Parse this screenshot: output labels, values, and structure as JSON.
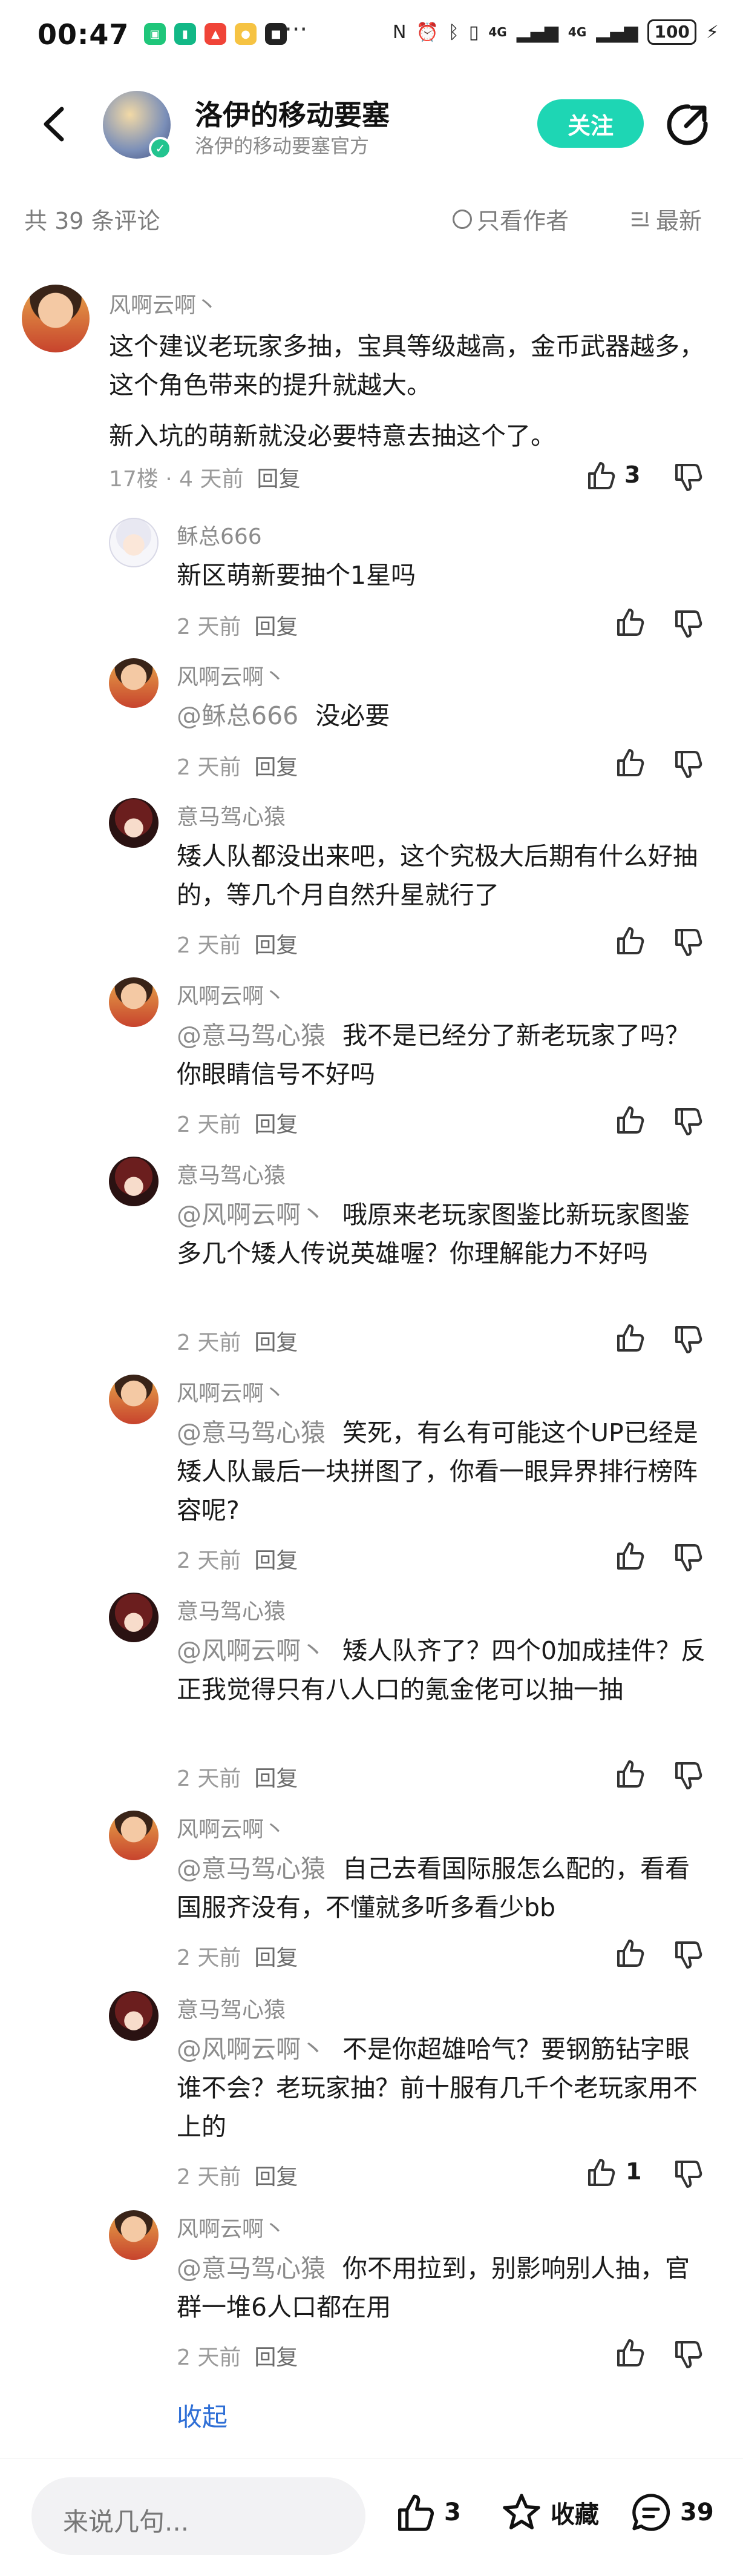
{
  "status_bar": {
    "time": "00:47",
    "more": "···",
    "signal_a": "4G",
    "signal_b": "4G",
    "battery": "100"
  },
  "header": {
    "title": "洛伊的移动要塞",
    "subtitle": "洛伊的移动要塞官方",
    "follow_label": "关注"
  },
  "sort_bar": {
    "count": "共 39 条评论",
    "only_author": "只看作者",
    "sort": "最新"
  },
  "main_comment": {
    "user": "风啊云啊丶",
    "text_1": "这个建议老玩家多抽，宝具等级越高，金币武器越多，这个角色带来的提升就越大。",
    "text_2": "新入坑的萌新就没必要特意去抽这个了。",
    "meta": "17楼 · 4 天前",
    "reply_label": "回复",
    "likes": "3"
  },
  "replies": [
    {
      "user": "稣总666",
      "mention": "",
      "text": "新区萌新要抽个1星吗",
      "time": "2 天前",
      "reply": "回复",
      "likes": ""
    },
    {
      "user": "风啊云啊丶",
      "mention": "@稣总666",
      "text": "没必要",
      "time": "2 天前",
      "reply": "回复",
      "likes": ""
    },
    {
      "user": "意马驾心猿",
      "mention": "",
      "text": "矮人队都没出来吧，这个究极大后期有什么好抽的，等几个月自然升星就行了",
      "time": "2 天前",
      "reply": "回复",
      "likes": ""
    },
    {
      "user": "风啊云啊丶",
      "mention": "@意马驾心猿",
      "text": "我不是已经分了新老玩家了吗？你眼睛信号不好吗",
      "time": "2 天前",
      "reply": "回复",
      "likes": ""
    },
    {
      "user": "意马驾心猿",
      "mention": "@风啊云啊丶",
      "text": "哦原来老玩家图鉴比新玩家图鉴多几个矮人传说英雄喔？你理解能力不好吗",
      "time": "2 天前",
      "reply": "回复",
      "likes": ""
    },
    {
      "user": "风啊云啊丶",
      "mention": "@意马驾心猿",
      "text": "笑死，有么有可能这个UP已经是矮人队最后一块拼图了，你看一眼异界排行榜阵容呢?",
      "time": "2 天前",
      "reply": "回复",
      "likes": ""
    },
    {
      "user": "意马驾心猿",
      "mention": "@风啊云啊丶",
      "text": "矮人队齐了？四个0加成挂件？反正我觉得只有八人口的氪金佬可以抽一抽",
      "time": "2 天前",
      "reply": "回复",
      "likes": ""
    },
    {
      "user": "风啊云啊丶",
      "mention": "@意马驾心猿",
      "text": "自己去看国际服怎么配的，看看国服齐没有，不懂就多听多看少bb",
      "time": "2 天前",
      "reply": "回复",
      "likes": ""
    },
    {
      "user": "意马驾心猿",
      "mention": "@风啊云啊丶",
      "text": "不是你超雄哈气？要钢筋钻字眼谁不会？老玩家抽？前十服有几千个老玩家用不上的",
      "time": "2 天前",
      "reply": "回复",
      "likes": "1"
    },
    {
      "user": "风啊云啊丶",
      "mention": "@意马驾心猿",
      "text": "你不用拉到，别影响别人抽，官群一堆6人口都在用",
      "time": "2 天前",
      "reply": "回复",
      "likes": ""
    }
  ],
  "collapse_label": "收起",
  "bottom_bar": {
    "input_placeholder": "来说几句...",
    "like_count": "3",
    "favorite_label": "收藏",
    "comment_count": "39"
  },
  "colors": {
    "accent": "#1ed6b4",
    "link": "#2f6fd6",
    "muted": "#8c8c8c"
  }
}
